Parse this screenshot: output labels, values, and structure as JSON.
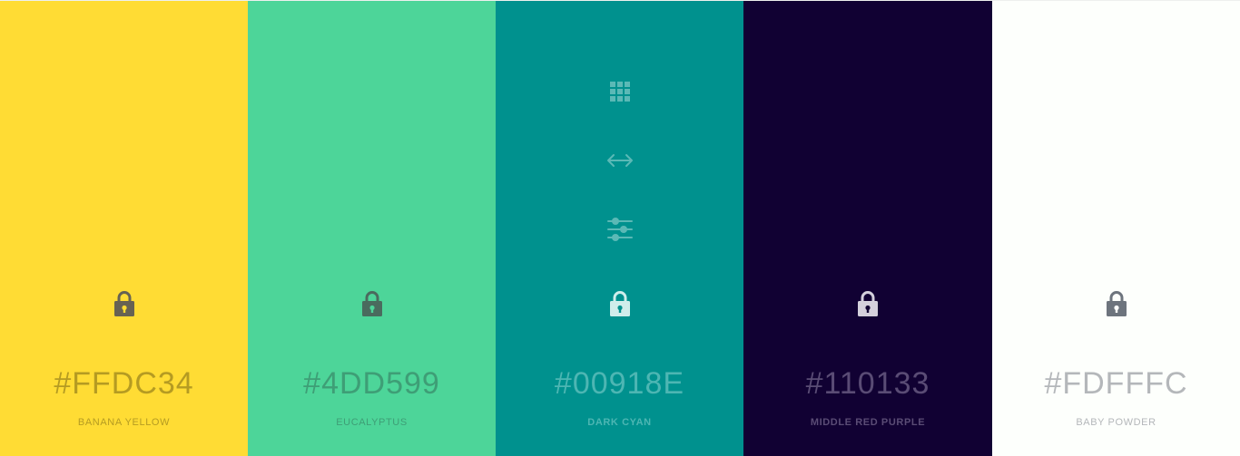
{
  "swatches": [
    {
      "hex": "#FFDC34",
      "name": "BANANA YELLOW",
      "background": "#FFDC34",
      "text_color": "#B59B22",
      "lock_color": "#676253",
      "bold_name": false
    },
    {
      "hex": "#4DD599",
      "name": "EUCALYPTUS",
      "background": "#4DD599",
      "text_color": "#3E9E76",
      "lock_color": "#4A6B5E",
      "bold_name": false
    },
    {
      "hex": "#00918E",
      "name": "DARK CYAN",
      "background": "#00918E",
      "text_color": "#4DB6B3",
      "lock_color": "#CFEDEB",
      "bold_name": true
    },
    {
      "hex": "#110133",
      "name": "MIDDLE RED PURPLE",
      "background": "#110133",
      "text_color": "#5A4C75",
      "lock_color": "#D4D0DC",
      "bold_name": true
    },
    {
      "hex": "#FDFFFC",
      "name": "BABY POWDER",
      "background": "#FDFFFC",
      "text_color": "#B4B7BA",
      "lock_color": "#6D747D",
      "bold_name": false
    }
  ],
  "hover_tools": {
    "swatch_index": 2,
    "color": "#5BB9B6",
    "icons": [
      "grid-icon",
      "arrows-horizontal-icon",
      "sliders-icon"
    ]
  }
}
